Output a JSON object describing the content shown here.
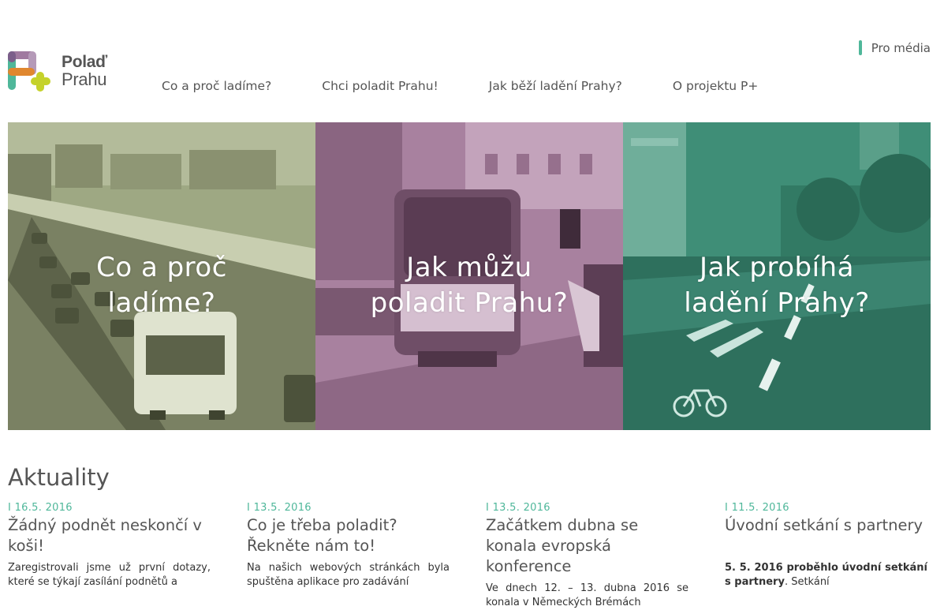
{
  "logo": {
    "line1": "Polaď",
    "line2": "Prahu"
  },
  "media_link": "Pro média",
  "nav": [
    "Co a proč ladíme?",
    "Chci poladit Prahu!",
    "Jak běží ladění Prahy?",
    "O projektu P+"
  ],
  "hero": [
    {
      "caption_l1": "Co a proč",
      "caption_l2": "ladíme?",
      "tint": "#9ea883"
    },
    {
      "caption_l1": "Jak můžu",
      "caption_l2": "poladit Prahu?",
      "tint": "#a8819f"
    },
    {
      "caption_l1": "Jak probíhá",
      "caption_l2": "ladění Prahy?",
      "tint": "#3f8e77"
    }
  ],
  "news_title": "Aktuality",
  "news": [
    {
      "date": "I 16.5. 2016",
      "headline": "Žádný podnět neskončí v koši!",
      "excerpt": " Zaregistrovali jsme už první dotazy, které se týkají zasílání podnětů a"
    },
    {
      "date": "I 13.5. 2016",
      "headline": "Co je třeba poladit? Řekněte nám to!",
      "excerpt": "Na našich webových stránkách byla spuštěna aplikace pro zadávání"
    },
    {
      "date": "I 13.5. 2016",
      "headline": "Začátkem dubna se konala evropská konference",
      "excerpt": "Ve dnech 12. – 13. dubna 2016 se konala v Německých Brémách"
    },
    {
      "date": "I 11.5. 2016",
      "headline": "Úvodní setkání s partnery",
      "excerpt_bold": "5. 5. 2016 proběhlo úvodní setkání s partnery",
      "excerpt_rest": ". Setkání"
    }
  ],
  "colors": {
    "accent": "#4fb79a",
    "text": "#555555"
  }
}
